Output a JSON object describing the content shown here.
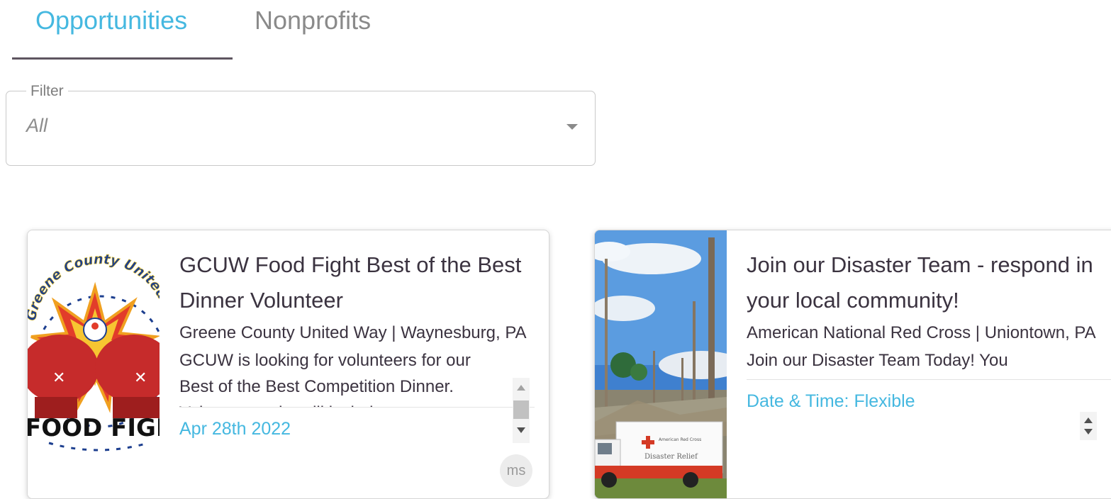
{
  "tabs": [
    {
      "label": "Opportunities",
      "active": true
    },
    {
      "label": "Nonprofits",
      "active": false
    }
  ],
  "filter": {
    "legend": "Filter",
    "value": "All"
  },
  "cards": [
    {
      "title": "GCUW Food Fight Best of the Best Dinner Volunteer",
      "org": "Greene County United Way | Waynesburg, PA",
      "description": "GCUW is looking for volunteers for our Best of the Best Competition Dinner. Volunteer tasks will include",
      "date": "Apr 28th 2022",
      "avatar": "ms",
      "image": {
        "logo_ring_text": "Greene County United Way",
        "logo_text": "FOOD FIGHT"
      }
    },
    {
      "title": "Join our Disaster Team - respond in your local community!",
      "org": "American National Red Cross | Uniontown, PA",
      "description": "Join our Disaster Team Today! You",
      "date": "Date & Time: Flexible",
      "image": {
        "truck_text": "Disaster Relief",
        "truck_logo_text": "American Red Cross"
      }
    }
  ],
  "colors": {
    "accent": "#45b8e0",
    "text": "#3b3340",
    "tab_inactive": "#8a8a8a",
    "underline": "#5e5560"
  }
}
